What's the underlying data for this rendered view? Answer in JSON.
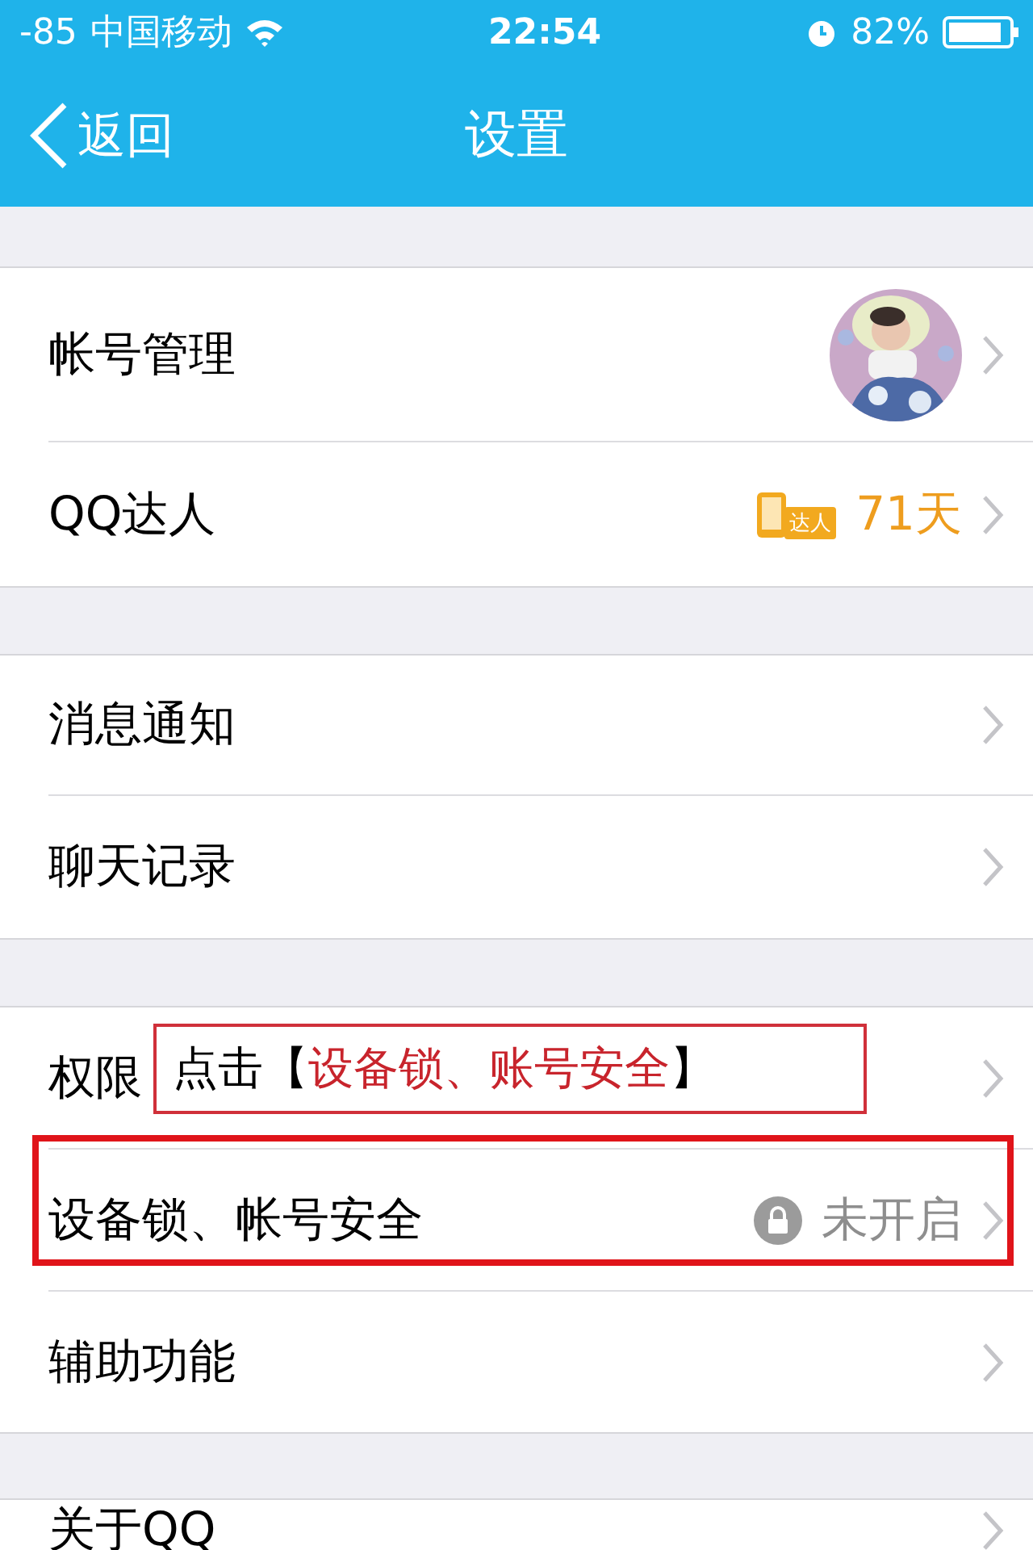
{
  "status_bar": {
    "signal": "-85",
    "carrier": "中国移动",
    "time": "22:54",
    "battery": "82%"
  },
  "nav": {
    "back": "返回",
    "title": "设置"
  },
  "groups": [
    {
      "rows": [
        {
          "kind": "avatar",
          "label": "帐号管理"
        },
        {
          "kind": "badge",
          "label": "QQ达人",
          "badge": "达人",
          "value": "71天"
        }
      ]
    },
    {
      "rows": [
        {
          "kind": "plain",
          "label": "消息通知"
        },
        {
          "kind": "plain",
          "label": "聊天记录"
        }
      ]
    },
    {
      "rows": [
        {
          "kind": "plain",
          "label": "权限"
        },
        {
          "kind": "lock",
          "label": "设备锁、帐号安全",
          "value": "未开启",
          "highlighted": true
        },
        {
          "kind": "plain",
          "label": "辅助功能"
        }
      ]
    },
    {
      "rows": [
        {
          "kind": "plain",
          "label": "关于QQ"
        }
      ]
    }
  ],
  "annotation": {
    "prefix": "点击",
    "open": "【",
    "emphasis": "设备锁、账号安全",
    "close": "】"
  }
}
